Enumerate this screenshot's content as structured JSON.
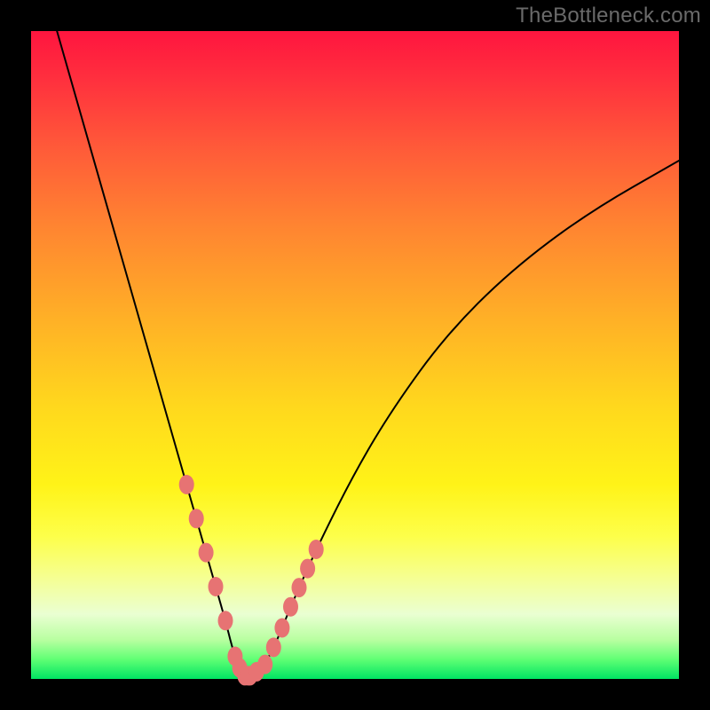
{
  "watermark": "TheBottleneck.com",
  "colors": {
    "background": "#000000",
    "bead": "#e77373",
    "curve": "#000000",
    "gradient_top": "#ff153f",
    "gradient_bottom": "#00e463"
  },
  "chart_data": {
    "type": "line",
    "title": "",
    "xlabel": "",
    "ylabel": "",
    "xlim": [
      0,
      100
    ],
    "ylim": [
      0,
      100
    ],
    "grid": false,
    "legend": false,
    "series": [
      {
        "name": "bottleneck-curve",
        "x": [
          4,
          8,
          12,
          16,
          20,
          24,
          26,
          28,
          30,
          31,
          32,
          33,
          34,
          36,
          38,
          40,
          44,
          50,
          56,
          64,
          74,
          86,
          100
        ],
        "y": [
          100,
          86,
          72,
          58,
          44,
          30,
          23,
          16,
          9,
          5,
          2,
          0.5,
          0.5,
          2,
          6,
          11,
          20,
          32,
          42,
          53,
          63,
          72,
          80
        ]
      }
    ],
    "annotations": {
      "beads_x_range": [
        24,
        44
      ],
      "beads_count_left": 6,
      "beads_count_right": 9,
      "minimum_x": 33
    }
  }
}
